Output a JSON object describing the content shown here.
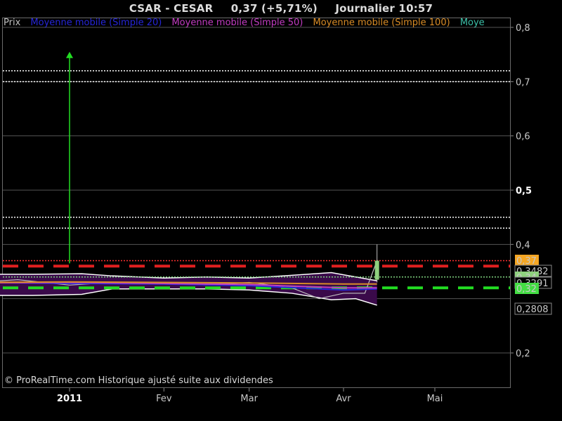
{
  "header": {
    "ticker": "CSAR - CESAR",
    "quote": "0,37 (+5,71%)",
    "period_time": "Journalier  10:57"
  },
  "legend": [
    {
      "label": "Prix",
      "color": "#c0c0c0"
    },
    {
      "label": "Moyenne mobile (Simple 20)",
      "color": "#2626d9"
    },
    {
      "label": "Moyenne mobile (Simple 50)",
      "color": "#c23cc2"
    },
    {
      "label": "Moyenne mobile (Simple 100)",
      "color": "#d98c26"
    },
    {
      "label": "Moye",
      "color": "#3cc0a8"
    }
  ],
  "footer": {
    "copyright": "© ProRealTime.com Historique ajusté suite aux dividendes"
  },
  "chart_data": {
    "type": "line",
    "title": "CSAR - CESAR",
    "xlabel": "",
    "ylabel": "",
    "ylim": [
      0.2,
      0.8
    ],
    "grid": true,
    "x_ticks": [
      {
        "label": "2011",
        "date": "2011-01-01",
        "bold": true
      },
      {
        "label": "Fev",
        "date": "2011-02-01",
        "bold": false
      },
      {
        "label": "Mar",
        "date": "2011-03-01",
        "bold": false
      },
      {
        "label": "Avr",
        "date": "2011-04-01",
        "bold": false
      },
      {
        "label": "Mai",
        "date": "2011-05-01",
        "bold": false
      }
    ],
    "x_range": [
      "2010-12-01",
      "2011-05-31"
    ],
    "y_ticks": [
      {
        "label": "0,8",
        "value": 0.8,
        "bold": false
      },
      {
        "label": "0,7",
        "value": 0.7,
        "bold": false
      },
      {
        "label": "0,6",
        "value": 0.6,
        "bold": false
      },
      {
        "label": "0,5",
        "value": 0.5,
        "bold": true
      },
      {
        "label": "0,4",
        "value": 0.4,
        "bold": false
      },
      {
        "label": "0,2",
        "value": 0.2,
        "bold": false
      }
    ],
    "price_labels": [
      {
        "label": "0,37",
        "value": 0.37,
        "bg": "#f5a623",
        "fg": "#000000"
      },
      {
        "label": "0,3482",
        "value": 0.3482,
        "bg": "#000000",
        "fg": "#dddddd"
      },
      {
        "label": "0,34",
        "value": 0.34,
        "bg": "#8fd17e",
        "fg": "#000000"
      },
      {
        "label": "0,3291",
        "value": 0.3291,
        "bg": "#000000",
        "fg": "#dddddd"
      },
      {
        "label": "0,32",
        "value": 0.32,
        "bg": "#44dd44",
        "fg": "#000000"
      },
      {
        "label": "0,2808",
        "value": 0.2808,
        "bg": "#000000",
        "fg": "#ffffff"
      }
    ],
    "horizontal_lines": [
      {
        "value": 0.72,
        "style": "dotted",
        "color": "#ffffff"
      },
      {
        "value": 0.7,
        "style": "dotted",
        "color": "#ffffff"
      },
      {
        "value": 0.45,
        "style": "dotted",
        "color": "#ffffff"
      },
      {
        "value": 0.43,
        "style": "dotted",
        "color": "#ffffff"
      },
      {
        "value": 0.37,
        "style": "dotted",
        "color": "#ff3030"
      },
      {
        "value": 0.34,
        "style": "dotted",
        "color": "#7fd27f"
      }
    ],
    "resistance": {
      "value": 0.36,
      "color": "#e02020"
    },
    "support": {
      "value": 0.32,
      "color": "#22dd22"
    },
    "arrow": {
      "date": "2011-01-01",
      "from": 0.365,
      "to": 0.755,
      "color": "#22dd22"
    },
    "series": [
      {
        "name": "Prix",
        "color": "#c0c0c0",
        "x": [
          "2010-12-01",
          "2010-12-15",
          "2011-01-01",
          "2011-01-15",
          "2011-02-01",
          "2011-02-15",
          "2011-03-01",
          "2011-03-15",
          "2011-03-24",
          "2011-04-01",
          "2011-04-08",
          "2011-04-12"
        ],
        "values": [
          0.33,
          0.335,
          0.325,
          0.33,
          0.33,
          0.325,
          0.33,
          0.32,
          0.3,
          0.31,
          0.31,
          0.37
        ]
      },
      {
        "name": "Moyenne mobile (Simple 20)",
        "color": "#2626d9",
        "x": [
          "2010-12-01",
          "2011-01-01",
          "2011-02-01",
          "2011-03-01",
          "2011-04-01",
          "2011-04-12"
        ],
        "values": [
          0.33,
          0.328,
          0.327,
          0.324,
          0.316,
          0.318
        ]
      },
      {
        "name": "Moyenne mobile (Simple 50)",
        "color": "#c23cc2",
        "x": [
          "2010-12-01",
          "2011-01-01",
          "2011-02-01",
          "2011-03-01",
          "2011-04-01",
          "2011-04-12"
        ],
        "values": [
          0.329,
          0.33,
          0.328,
          0.326,
          0.32,
          0.32
        ]
      },
      {
        "name": "Moyenne mobile (Simple 100)",
        "color": "#d98c26",
        "x": [
          "2010-12-01",
          "2011-01-01",
          "2011-02-01",
          "2011-03-01",
          "2011-04-01",
          "2011-04-12"
        ],
        "values": [
          0.33,
          0.331,
          0.33,
          0.329,
          0.327,
          0.327
        ]
      }
    ],
    "bollinger": {
      "color": "#ffffff",
      "fill": "#3a0a4a",
      "x": [
        "2010-12-01",
        "2010-12-20",
        "2011-01-05",
        "2011-01-15",
        "2011-02-01",
        "2011-02-15",
        "2011-03-01",
        "2011-03-15",
        "2011-03-28",
        "2011-04-05",
        "2011-04-12"
      ],
      "upper": [
        0.345,
        0.345,
        0.346,
        0.342,
        0.338,
        0.34,
        0.338,
        0.343,
        0.348,
        0.34,
        0.333
      ],
      "lower": [
        0.306,
        0.306,
        0.308,
        0.318,
        0.318,
        0.318,
        0.316,
        0.31,
        0.298,
        0.3,
        0.288
      ]
    }
  }
}
